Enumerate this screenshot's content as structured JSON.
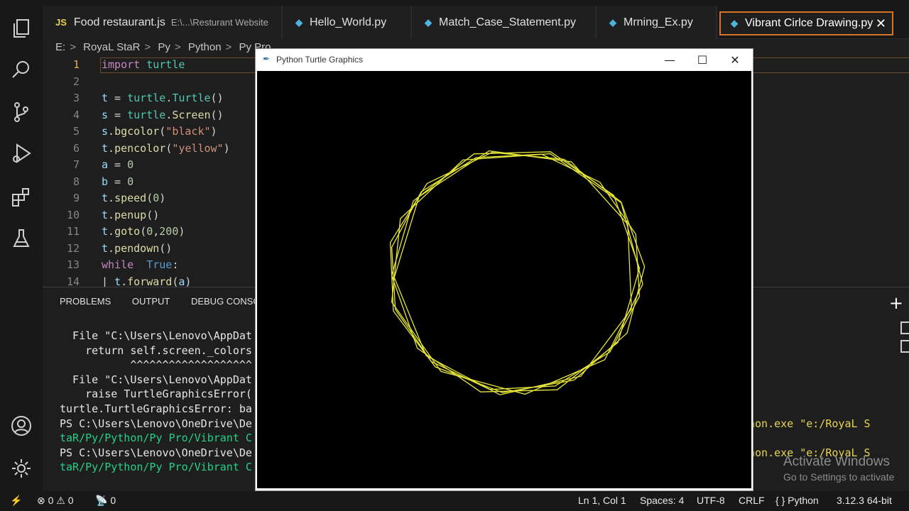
{
  "activity_bar": {
    "icons": [
      "explorer-icon",
      "search-icon",
      "source-control-icon",
      "run-debug-icon",
      "extensions-icon",
      "testing-icon",
      "account-icon",
      "settings-gear-icon"
    ]
  },
  "tabs": [
    {
      "icon": "JS",
      "label": "Food restaurant.js",
      "path": "E:\\...\\Resturant Website"
    },
    {
      "icon": "◆",
      "label": "Hello_World.py"
    },
    {
      "icon": "◆",
      "label": "Match_Case_Statement.py"
    },
    {
      "icon": "◆",
      "label": "Mrning_Ex.py"
    },
    {
      "icon": "◆",
      "label": "Vibrant Cirlce Drawing.py",
      "close": "✕"
    }
  ],
  "breadcrumb": [
    "E:",
    "RoyaL StaR",
    "Py",
    "Python",
    "Py Pro"
  ],
  "editor": {
    "line_numbers": [
      "1",
      "2",
      "3",
      "4",
      "5",
      "6",
      "7",
      "8",
      "9",
      "10",
      "11",
      "12",
      "13",
      "14"
    ]
  },
  "panel": {
    "tabs": [
      "PROBLEMS",
      "OUTPUT",
      "DEBUG CONSOL"
    ],
    "plus": "+",
    "terminal": [
      "  File \"C:\\Users\\Lenovo\\AppDat",
      "    return self.screen._colors",
      "           ^^^^^^^^^^^^^^^^^^^",
      "  File \"C:\\Users\\Lenovo\\AppDat",
      "    raise TurtleGraphicsError(",
      "turtle.TurtleGraphicsError: ba",
      "PS C:\\Users\\Lenovo\\OneDrive\\De",
      "taR/Py/Python/Py Pro/Vibrant C",
      "PS C:\\Users\\Lenovo\\OneDrive\\De",
      "taR/Py/Python/Py Pro/Vibrant C"
    ],
    "terminal_right": "non.exe \"e:/RoyaL S"
  },
  "watermark": {
    "line1": "Activate Windows",
    "line2": "Go to Settings to activate"
  },
  "status_bar": {
    "remote": "⚡",
    "problems": "⊗ 0 ⚠ 0",
    "ports": "📡 0",
    "position": "Ln 1, Col 1",
    "spaces": "Spaces: 4",
    "encoding": "UTF-8",
    "eol": "CRLF",
    "language": "{ } Python",
    "interpreter": "3.12.3 64-bit"
  },
  "turtle_window": {
    "title": "Python Turtle Graphics",
    "minimize": "—",
    "maximize": "☐",
    "close": "✕",
    "pen_color": "#e6e63a",
    "background": "#000000"
  }
}
